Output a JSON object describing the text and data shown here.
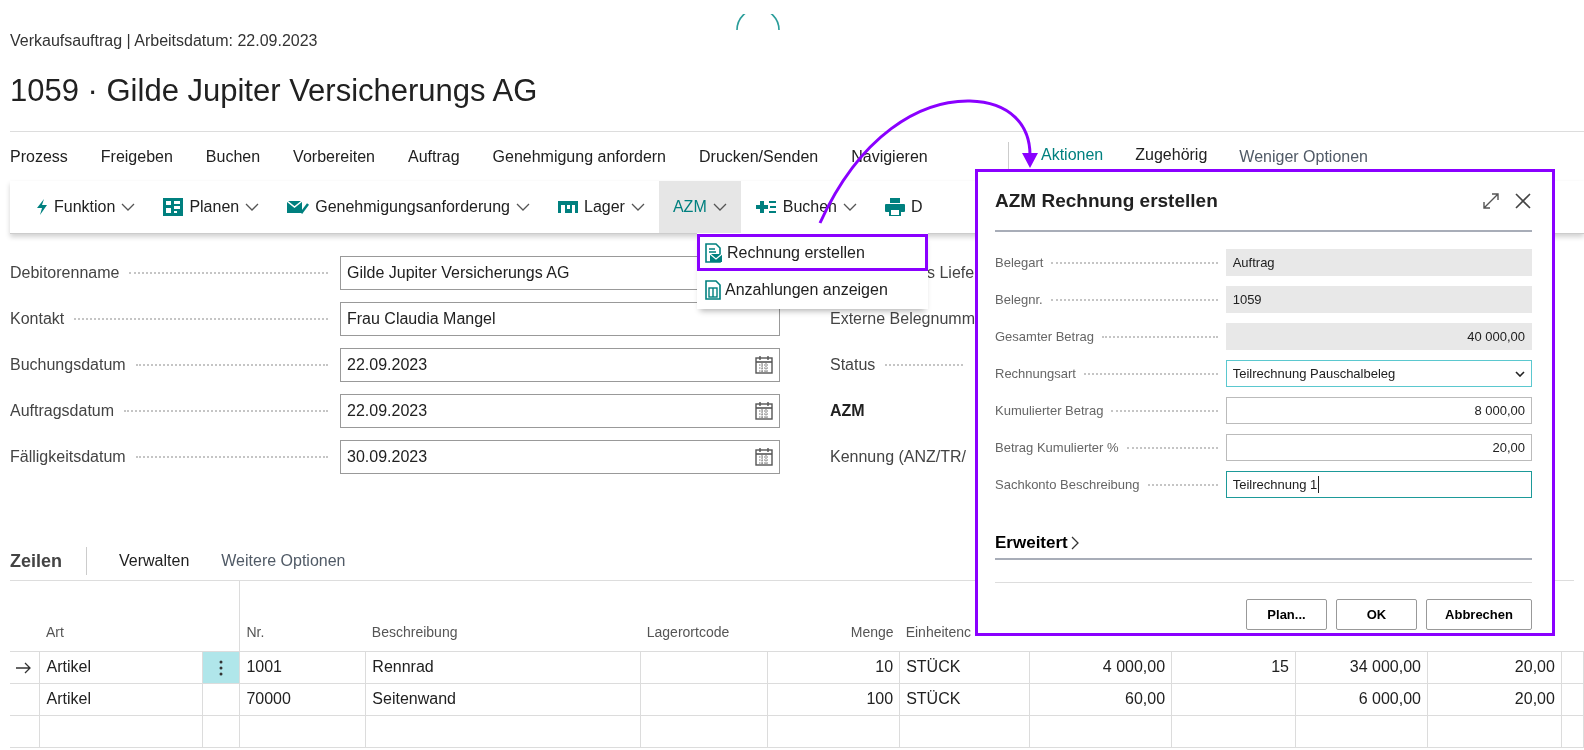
{
  "breadcrumb": "Verkaufsauftrag | Arbeitsdatum: 22.09.2023",
  "title": "1059 · Gilde Jupiter Versicherungs AG",
  "menu_groups": [
    "Prozess",
    "Freigeben",
    "Buchen",
    "Vorbereiten",
    "Auftrag",
    "Genehmigung anfordern",
    "Drucken/Senden",
    "Navigieren"
  ],
  "tabs": [
    {
      "label": "Aktionen",
      "selected": true
    },
    {
      "label": "Zugehörig",
      "selected": false
    }
  ],
  "less_options": "Weniger Optionen",
  "toolbar": [
    {
      "label": "Funktion",
      "caret": true,
      "active": false
    },
    {
      "label": "Planen",
      "caret": true,
      "active": false
    },
    {
      "label": "Genehmigungsanforderung",
      "caret": true,
      "active": false
    },
    {
      "label": "Lager",
      "caret": true,
      "active": false
    },
    {
      "label": "AZM",
      "caret": true,
      "active": true
    },
    {
      "label": "Buchen",
      "caret": true,
      "active": false
    },
    {
      "label": "D",
      "caret": false,
      "active": false
    }
  ],
  "dropdown_menu": [
    {
      "label": "Rechnung erstellen",
      "highlighted": true
    },
    {
      "label": "Anzahlungen anzeigen",
      "highlighted": false
    }
  ],
  "form": {
    "left": [
      {
        "label": "Debitorenname",
        "value": "Gilde Jupiter Versicherungs AG",
        "kind": "text"
      },
      {
        "label": "Kontakt",
        "value": "Frau Claudia Mangel",
        "kind": "text"
      },
      {
        "label": "Buchungsdatum",
        "value": "22.09.2023",
        "kind": "date"
      },
      {
        "label": "Auftragsdatum",
        "value": "22.09.2023",
        "kind": "date"
      },
      {
        "label": "Fälligkeitsdatum",
        "value": "30.09.2023",
        "kind": "date"
      }
    ],
    "right": [
      {
        "label": "s Liefe",
        "kind": "partial"
      },
      {
        "label": "Externe Belegnumm",
        "kind": "label"
      },
      {
        "label": "Status",
        "kind": "leader"
      },
      {
        "label": "AZM",
        "kind": "heading"
      },
      {
        "label": "Kennung (ANZ/TR/",
        "kind": "label"
      }
    ]
  },
  "lines": {
    "title": "Zeilen",
    "actions": [
      {
        "label": "Verwalten",
        "kind": "primary"
      },
      {
        "label": "Weitere Optionen",
        "kind": "more"
      }
    ]
  },
  "table": {
    "columns": [
      "Art",
      "Nr.",
      "Beschreibung",
      "Lagerortcode",
      "Menge",
      "Einheitenc"
    ],
    "rows": [
      {
        "current": true,
        "art": "Artikel",
        "nr": "1001",
        "beschreibung": "Rennrad",
        "menge": "10",
        "einheit": "STÜCK",
        "column_8": "4 000,00",
        "column_9": "15",
        "column_10": "34 000,00",
        "column_11": "20,00"
      },
      {
        "current": false,
        "art": "Artikel",
        "nr": "70000",
        "beschreibung": "Seitenwand",
        "menge": "100",
        "einheit": "STÜCK",
        "column_8": "60,00",
        "column_10": "6 000,00",
        "column_11": "20,00"
      }
    ]
  },
  "dialog": {
    "title": "AZM Rechnung erstellen",
    "fields": [
      {
        "label": "Belegart",
        "value": "Auftrag",
        "kind": "readonly"
      },
      {
        "label": "Belegnr.",
        "value": "1059",
        "kind": "readonly"
      },
      {
        "label": "Gesamter Betrag",
        "value": "40 000,00",
        "kind": "readonly-number"
      },
      {
        "label": "Rechnungsart",
        "value": "Teilrechnung Pauschalbeleg",
        "kind": "select"
      },
      {
        "label": "Kumulierter Betrag",
        "value": "8 000,00",
        "kind": "number"
      },
      {
        "label": "Betrag Kumulierter %",
        "value": "20,00",
        "kind": "number"
      },
      {
        "label": "Sachkonto Beschreibung",
        "value": "Teilrechnung 1",
        "kind": "focused"
      }
    ],
    "section": "Erweitert",
    "buttons": [
      "Plan...",
      "OK",
      "Abbrechen"
    ]
  }
}
